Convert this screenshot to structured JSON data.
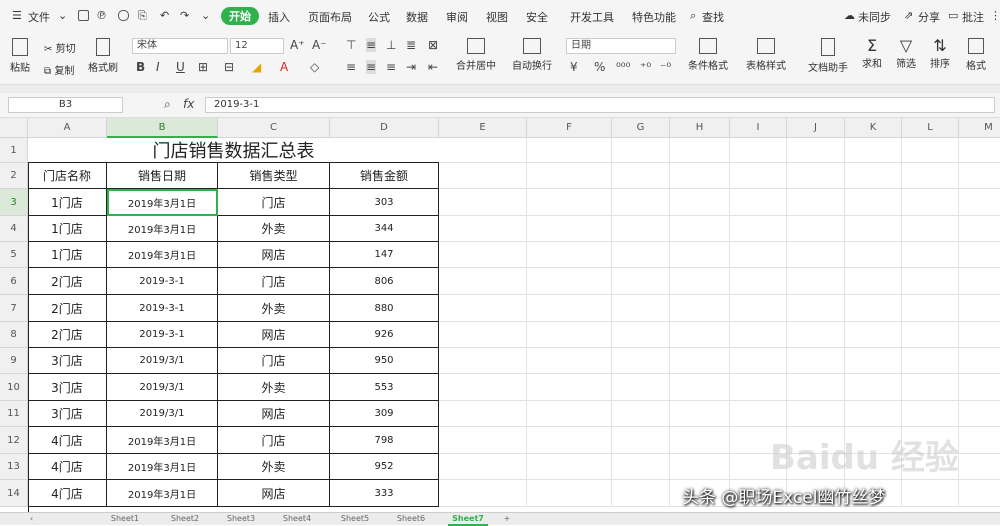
{
  "menubar": {
    "file_label": "文件",
    "tabs": [
      "开始",
      "插入",
      "页面布局",
      "公式",
      "数据",
      "审阅",
      "视图",
      "安全",
      "开发工具",
      "特色功能"
    ],
    "active_tab": "开始",
    "search_label": "查找",
    "sync_label": "未同步",
    "share_label": "分享",
    "comment_label": "批注"
  },
  "ribbon": {
    "cut": "剪切",
    "paste": "粘贴",
    "copy": "复制",
    "format_painter": "格式刷",
    "font_name": "宋体",
    "font_size": "12",
    "merge_center": "合并居中",
    "wrap_text": "自动换行",
    "number_format": "日期",
    "cond_format": "条件格式",
    "table_style": "表格样式",
    "doc_assist": "文档助手",
    "sum": "求和",
    "filter": "筛选",
    "sort": "排序",
    "format": "格式"
  },
  "formula_bar": {
    "name_box": "B3",
    "fx_label": "fx",
    "value": "2019-3-1"
  },
  "grid": {
    "columns": [
      "A",
      "B",
      "C",
      "D",
      "E",
      "F",
      "G",
      "H",
      "I",
      "J",
      "K",
      "L",
      "M"
    ],
    "selected_column": "B",
    "rows": [
      "1",
      "2",
      "3",
      "4",
      "5",
      "6",
      "7",
      "8",
      "9",
      "10",
      "11",
      "12",
      "13",
      "14"
    ],
    "selected_row": "3",
    "title": "门店销售数据汇总表",
    "headers": [
      "门店名称",
      "销售日期",
      "销售类型",
      "销售金额"
    ],
    "data": [
      [
        "1门店",
        "2019年3月1日",
        "门店",
        "303"
      ],
      [
        "1门店",
        "2019年3月1日",
        "外卖",
        "344"
      ],
      [
        "1门店",
        "2019年3月1日",
        "网店",
        "147"
      ],
      [
        "2门店",
        "2019-3-1",
        "门店",
        "806"
      ],
      [
        "2门店",
        "2019-3-1",
        "外卖",
        "880"
      ],
      [
        "2门店",
        "2019-3-1",
        "网店",
        "926"
      ],
      [
        "3门店",
        "2019/3/1",
        "门店",
        "950"
      ],
      [
        "3门店",
        "2019/3/1",
        "外卖",
        "553"
      ],
      [
        "3门店",
        "2019/3/1",
        "网店",
        "309"
      ],
      [
        "4门店",
        "2019年3月1日",
        "门店",
        "798"
      ],
      [
        "4门店",
        "2019年3月1日",
        "外卖",
        "952"
      ],
      [
        "4门店",
        "2019年3月1日",
        "网店",
        "333"
      ]
    ]
  },
  "sheets": {
    "tabs": [
      "Sheet1",
      "Sheet2",
      "Sheet3",
      "Sheet4",
      "Sheet5",
      "Sheet6"
    ],
    "active": "Sheet7",
    "add_label": "+"
  },
  "watermark": {
    "text": "头条 @职场Excel幽竹丝梦",
    "baidu": "Baidu 经验"
  }
}
